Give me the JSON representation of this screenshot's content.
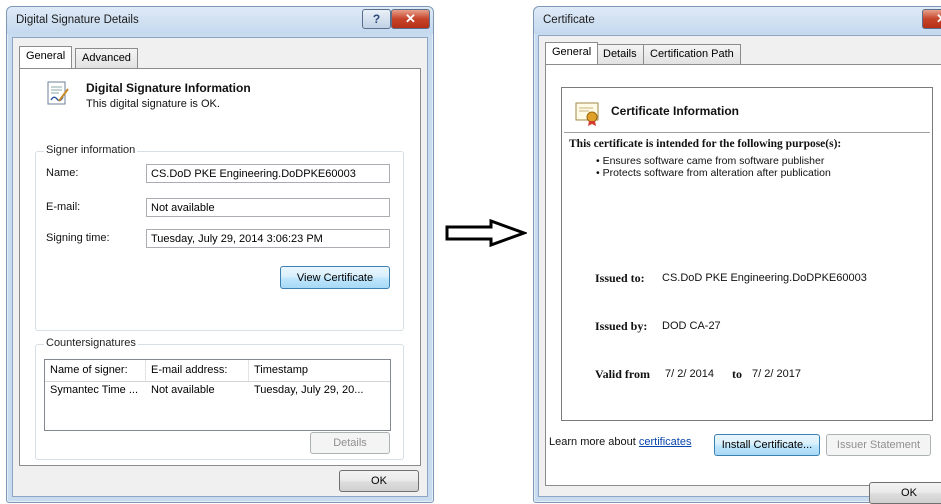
{
  "sig_window": {
    "title": "Digital Signature Details",
    "help_icon": "help-icon",
    "close_icon": "close-icon",
    "tabs": [
      {
        "label": "General"
      },
      {
        "label": "Advanced"
      }
    ],
    "header": {
      "title": "Digital Signature Information",
      "status": "This digital signature is OK.",
      "icon": "signature-document-icon"
    },
    "signer_group_label": "Signer information",
    "fields": {
      "name_label": "Name:",
      "name_value": "CS.DoD PKE Engineering.DoDPKE60003",
      "email_label": "E-mail:",
      "email_value": "Not available",
      "time_label": "Signing time:",
      "time_value": "Tuesday,  July  29,  2014 3:06:23 PM"
    },
    "view_cert_button": "View Certificate",
    "counter_group_label": "Countersignatures",
    "counter_columns": [
      "Name of signer:",
      "E-mail address:",
      "Timestamp"
    ],
    "counter_rows": [
      [
        "Symantec Time ...",
        "Not available",
        "Tuesday, July 29, 20..."
      ]
    ],
    "details_button": "Details",
    "ok_button": "OK"
  },
  "arrow_icon": "right-arrow-icon",
  "cert_window": {
    "title": "Certificate",
    "close_icon": "close-icon",
    "tabs": [
      {
        "label": "General"
      },
      {
        "label": "Details"
      },
      {
        "label": "Certification Path"
      }
    ],
    "info_title": "Certificate Information",
    "info_icon": "certificate-icon",
    "purpose_heading": "This certificate is intended for the following purpose(s):",
    "purposes": [
      "• Ensures software came from software publisher",
      "• Protects software from alteration after publication"
    ],
    "issued_to_label": "Issued to:",
    "issued_to_value": "CS.DoD PKE Engineering.DoDPKE60003",
    "issued_by_label": "Issued by:",
    "issued_by_value": "DOD CA-27",
    "valid_from_label": "Valid from",
    "valid_from_value": "7/ 2/ 2014",
    "valid_to_label": "to",
    "valid_to_value": "7/ 2/ 2017",
    "install_button": "Install Certificate...",
    "issuer_button": "Issuer Statement",
    "learn_more_text": "Learn more about",
    "learn_more_link": "certificates",
    "ok_button": "OK"
  }
}
